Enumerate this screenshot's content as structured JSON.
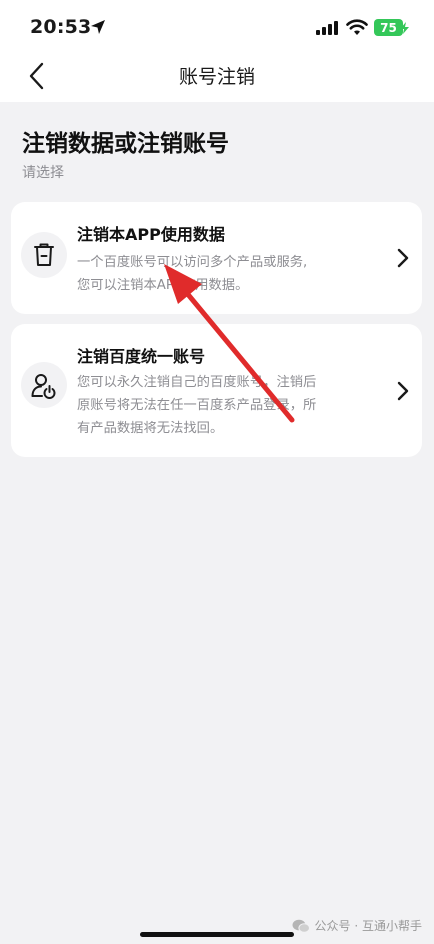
{
  "status_bar": {
    "time": "20:53",
    "battery": "75",
    "icons": [
      "location-arrow-icon",
      "cell-signal-icon",
      "wifi-icon",
      "battery-icon"
    ],
    "battery_color": "#34c759"
  },
  "nav": {
    "title": "账号注销",
    "back_icon": "chevron-left-icon"
  },
  "main": {
    "heading": "注销数据或注销账号",
    "subheading": "请选择",
    "options": [
      {
        "title": "注销本APP使用数据",
        "desc_lines": [
          "一个百度账号可以访问多个产品或服务,",
          "您可以注销本APP使用数据。"
        ],
        "icon": "trash-icon"
      },
      {
        "title": "注销百度统一账号",
        "desc_lines": [
          "您可以永久注销自己的百度账号，注销后",
          "原账号将无法在任一百度系产品登录，所",
          "有产品数据将无法找回。"
        ],
        "icon": "user-power-icon"
      }
    ]
  },
  "annotation": {
    "color": "#e02b2b"
  },
  "watermark": {
    "text": "公众号 · 互通小帮手",
    "icon": "wechat-icon"
  }
}
